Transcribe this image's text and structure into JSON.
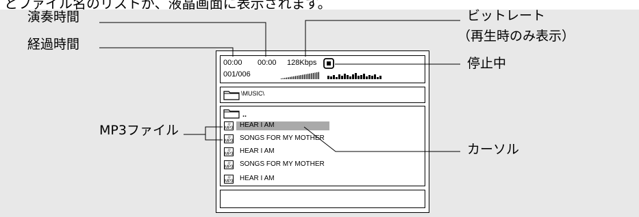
{
  "header_partial": "とファイル名のリストが、液晶画面に表示されます。",
  "callouts": {
    "playback_time": "演奏時間",
    "elapsed_time": "経過時間",
    "bitrate_line1": "ビットレート",
    "bitrate_line2": "（再生時のみ表示）",
    "stopped": "停止中",
    "mp3_file": "MP3ファイル",
    "cursor": "カーソル"
  },
  "screen": {
    "elapsed": "00:00",
    "total": "00:00",
    "bitrate": "128Kbps",
    "track": "001/006",
    "path": "\\MUSIC\\",
    "parent": "..",
    "files": [
      "HEAR I AM",
      "SONGS FOR MY MOTHER",
      "HEAR I AM",
      "SONGS FOR MY MOTHER",
      "HEAR I AM"
    ],
    "file_icon_label": "MP3",
    "selected_index": 0,
    "colors": {
      "cursor_highlight": "#a9a9a9",
      "panel_bg": "#e8e8e8"
    }
  }
}
